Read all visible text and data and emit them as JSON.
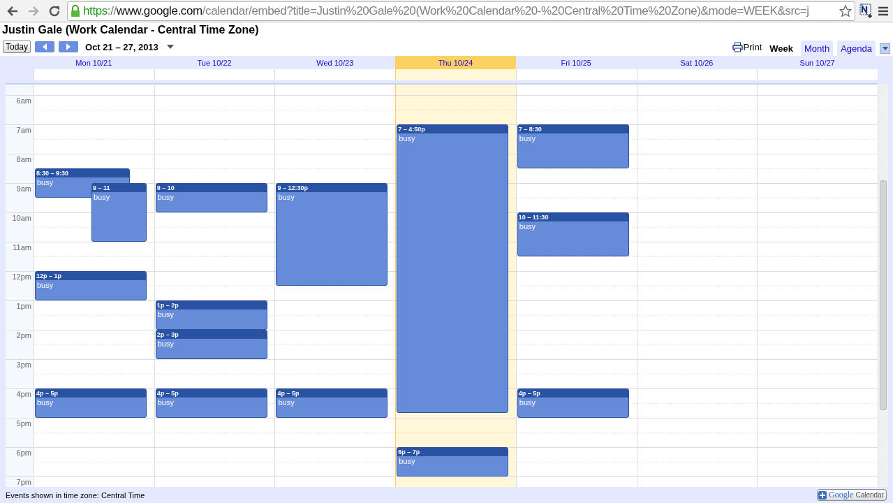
{
  "browser": {
    "url_parts": [
      {
        "kind": "secure",
        "text": "https"
      },
      {
        "kind": "muted",
        "text": "://"
      },
      {
        "kind": "host",
        "text": "www.google.com"
      },
      {
        "kind": "muted",
        "text": "/calendar/embed?title=Justin%20Gale%20(Work%20Calendar%20-%20Central%20Time%20Zone)&mode=WEEK&src=j"
      }
    ]
  },
  "title": "Justin Gale (Work Calendar - Central Time Zone)",
  "toolbar": {
    "today": "Today",
    "date_range": "Oct 21 – 27, 2013",
    "print": "Print"
  },
  "view_tabs": [
    {
      "label": "Week",
      "selected": true
    },
    {
      "label": "Month",
      "selected": false
    },
    {
      "label": "Agenda",
      "selected": false
    }
  ],
  "days": [
    {
      "label": "Mon 10/21",
      "selected": false,
      "events": [
        {
          "time": "8:30 – 9:30",
          "title": "busy",
          "kind": "left"
        },
        {
          "time": "9 – 11",
          "title": "busy",
          "kind": "right"
        },
        {
          "time": "12p – 1p",
          "title": "busy",
          "kind": "full"
        },
        {
          "time": "4p – 5p",
          "title": "busy",
          "kind": "full"
        }
      ]
    },
    {
      "label": "Tue 10/22",
      "selected": false,
      "events": [
        {
          "time": "9 – 10",
          "title": "busy",
          "kind": "full"
        },
        {
          "time": "1p – 2p",
          "title": "busy",
          "kind": "full"
        },
        {
          "time": "2p – 3p",
          "title": "busy",
          "kind": "full"
        },
        {
          "time": "4p – 5p",
          "title": "busy",
          "kind": "full"
        }
      ]
    },
    {
      "label": "Wed 10/23",
      "selected": false,
      "events": [
        {
          "time": "9 – 12:30p",
          "title": "busy",
          "kind": "full"
        },
        {
          "time": "4p – 5p",
          "title": "busy",
          "kind": "full"
        }
      ]
    },
    {
      "label": "Thu 10/24",
      "selected": true,
      "events": [
        {
          "time": "7 – 4:50p",
          "title": "busy",
          "kind": "full"
        },
        {
          "time": "6p – 7p",
          "title": "busy",
          "kind": "full"
        }
      ]
    },
    {
      "label": "Fri 10/25",
      "selected": false,
      "events": [
        {
          "time": "7 – 8:30",
          "title": "busy",
          "kind": "full"
        },
        {
          "time": "10 – 11:30",
          "title": "busy",
          "kind": "full"
        },
        {
          "time": "4p – 5p",
          "title": "busy",
          "kind": "full"
        }
      ]
    },
    {
      "label": "Sat 10/26",
      "selected": false
    },
    {
      "label": "Sun 10/27",
      "selected": false
    }
  ],
  "hours": [
    "6am",
    "7am",
    "8am",
    "9am",
    "10am",
    "11am",
    "12pm",
    "1pm",
    "2pm",
    "3pm",
    "4pm",
    "5pm",
    "6pm",
    "7pm"
  ],
  "footer": {
    "timezone_note": "Events shown in time zone: Central Time",
    "badge_logo": "Google",
    "badge_label": "Calendar"
  }
}
